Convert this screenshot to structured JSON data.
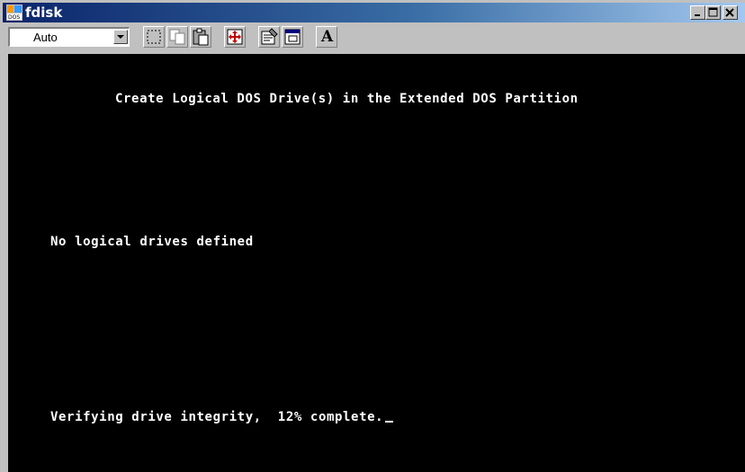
{
  "window": {
    "title": "fdisk",
    "icon": "ms-dos-icon",
    "caption_buttons": [
      "minimize-icon",
      "maximize-icon",
      "close-icon"
    ]
  },
  "toolbar": {
    "font_size_value": "Auto",
    "buttons": [
      "mark-icon",
      "copy-icon",
      "paste-icon",
      "full-screen-icon",
      "properties-icon",
      "background-icon",
      "font-icon"
    ],
    "font_button_label": "A"
  },
  "console": {
    "heading": "Create Logical DOS Drive(s) in the Extended DOS Partition",
    "message": "No logical drives defined",
    "status": "Verifying drive integrity,  12% complete.",
    "background": "#000000",
    "foreground": "#ffffff"
  }
}
